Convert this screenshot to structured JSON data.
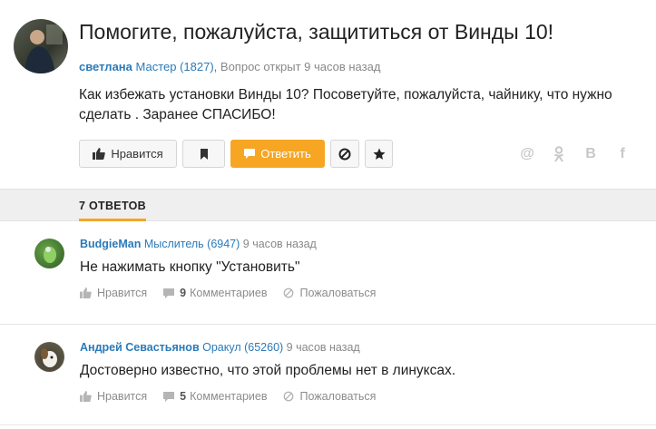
{
  "question": {
    "title": "Помогите, пожалуйста, защититься от Винды 10!",
    "author": "светлана",
    "rank": "Мастер (1827),",
    "status": "Вопрос открыт 9 часов назад",
    "body": "Как избежать установки Винды 10? Посоветуйте, пожалуйста, чайнику, что нужно сделать . Заранее СПАСИБО!"
  },
  "toolbar": {
    "like_label": "Нравится",
    "answer_label": "Ответить"
  },
  "answers_tab": {
    "label": "7 ОТВЕТОВ"
  },
  "answers": [
    {
      "author": "BudgieMan",
      "rank": "Мыслитель (6947)",
      "time": "9 часов назад",
      "text": "Не нажимать кнопку \"Установить\"",
      "like_label": "Нравится",
      "comments_count": "9",
      "comments_label": "Комментариев",
      "report_label": "Пожаловаться"
    },
    {
      "author": "Андрей Севастьянов",
      "rank": "Оракул (65260)",
      "time": "9 часов назад",
      "text": "Достоверно известно, что этой проблемы нет в линуксах.",
      "like_label": "Нравится",
      "comments_count": "5",
      "comments_label": "Комментариев",
      "report_label": "Пожаловаться"
    }
  ],
  "share_icons": [
    "at-icon",
    "odnoklassniki-icon",
    "vk-icon",
    "facebook-icon"
  ],
  "colors": {
    "accent": "#f6a623",
    "link": "#2a7ab8"
  }
}
